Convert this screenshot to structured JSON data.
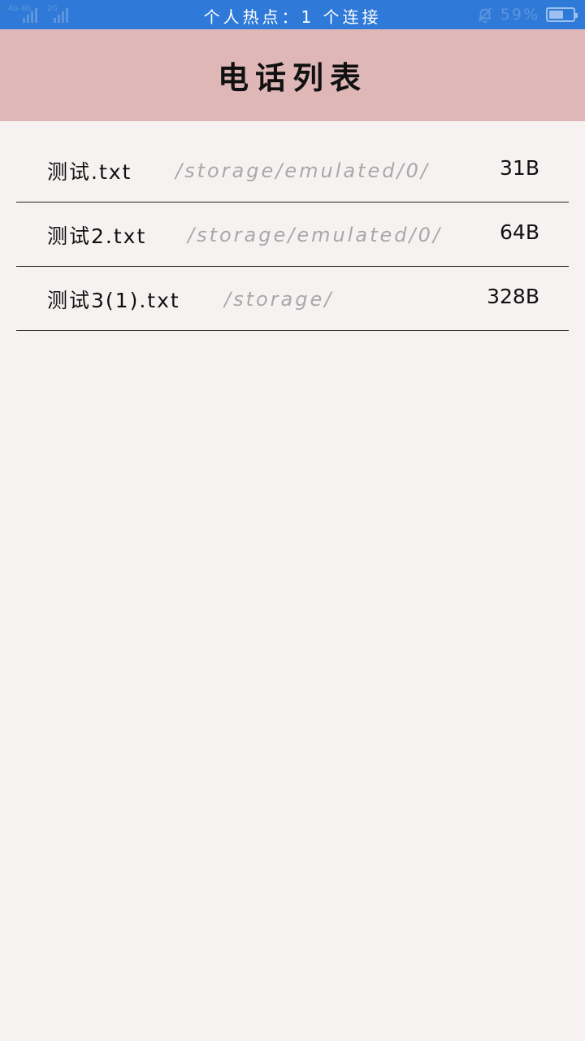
{
  "status_bar": {
    "left_network_1": "4G 4G",
    "left_network_2": "2G",
    "center_text": "个人热点：1 个连接",
    "mute_icon": "bell-off-icon",
    "battery_percent": "59%",
    "battery_level": 0.59,
    "colors": {
      "background": "#2f7ad8",
      "dim_icon": "#5f95dd"
    }
  },
  "header": {
    "title": "电话列表",
    "background": "#dfb7b7"
  },
  "files": [
    {
      "name": "测试.txt",
      "path": "/storage/emulated/0/",
      "size": "31B"
    },
    {
      "name": "测试2.txt",
      "path": "/storage/emulated/0/",
      "size": "64B"
    },
    {
      "name": "测试3(1).txt",
      "path": "/storage/",
      "size": "328B"
    }
  ]
}
